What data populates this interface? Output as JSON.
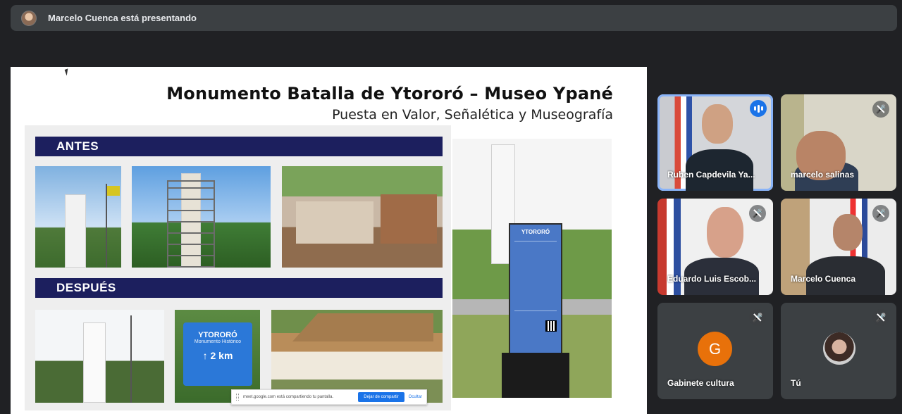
{
  "presenter": {
    "text": "Marcelo Cuenca está presentando"
  },
  "slide": {
    "title": "Monumento Batalla de Ytororó – Museo Ypané",
    "subtitle": "Puesta en Valor, Señalética y Museografía",
    "before_label": "ANTES",
    "after_label": "DESPUÉS",
    "sign": {
      "name": "YTORORÓ",
      "sub": "Monumento Histórico",
      "distance": "↑ 2 km"
    },
    "totem_title": "YTORORÓ"
  },
  "share_bar": {
    "text": "meet.google.com está compartiendo tu pantalla.",
    "stop_label": "Dejar de compartir",
    "hide_label": "Ocultar"
  },
  "participants": [
    {
      "name": "Ruben Capdevila Ya...",
      "status": "speaking"
    },
    {
      "name": "marcelo salinas",
      "status": "muted"
    },
    {
      "name": "Eduardo Luis Escob...",
      "status": "muted"
    },
    {
      "name": "Marcelo Cuenca",
      "status": "muted"
    },
    {
      "name": "Gabinete cultura",
      "status": "muted",
      "initial": "G",
      "color": "#e8710a"
    },
    {
      "name": "Tú",
      "status": "muted"
    }
  ],
  "colors": {
    "background": "#202124",
    "tile": "#3c4043",
    "active_outline": "#8ab4f8",
    "banner": "#1c1f5e"
  }
}
